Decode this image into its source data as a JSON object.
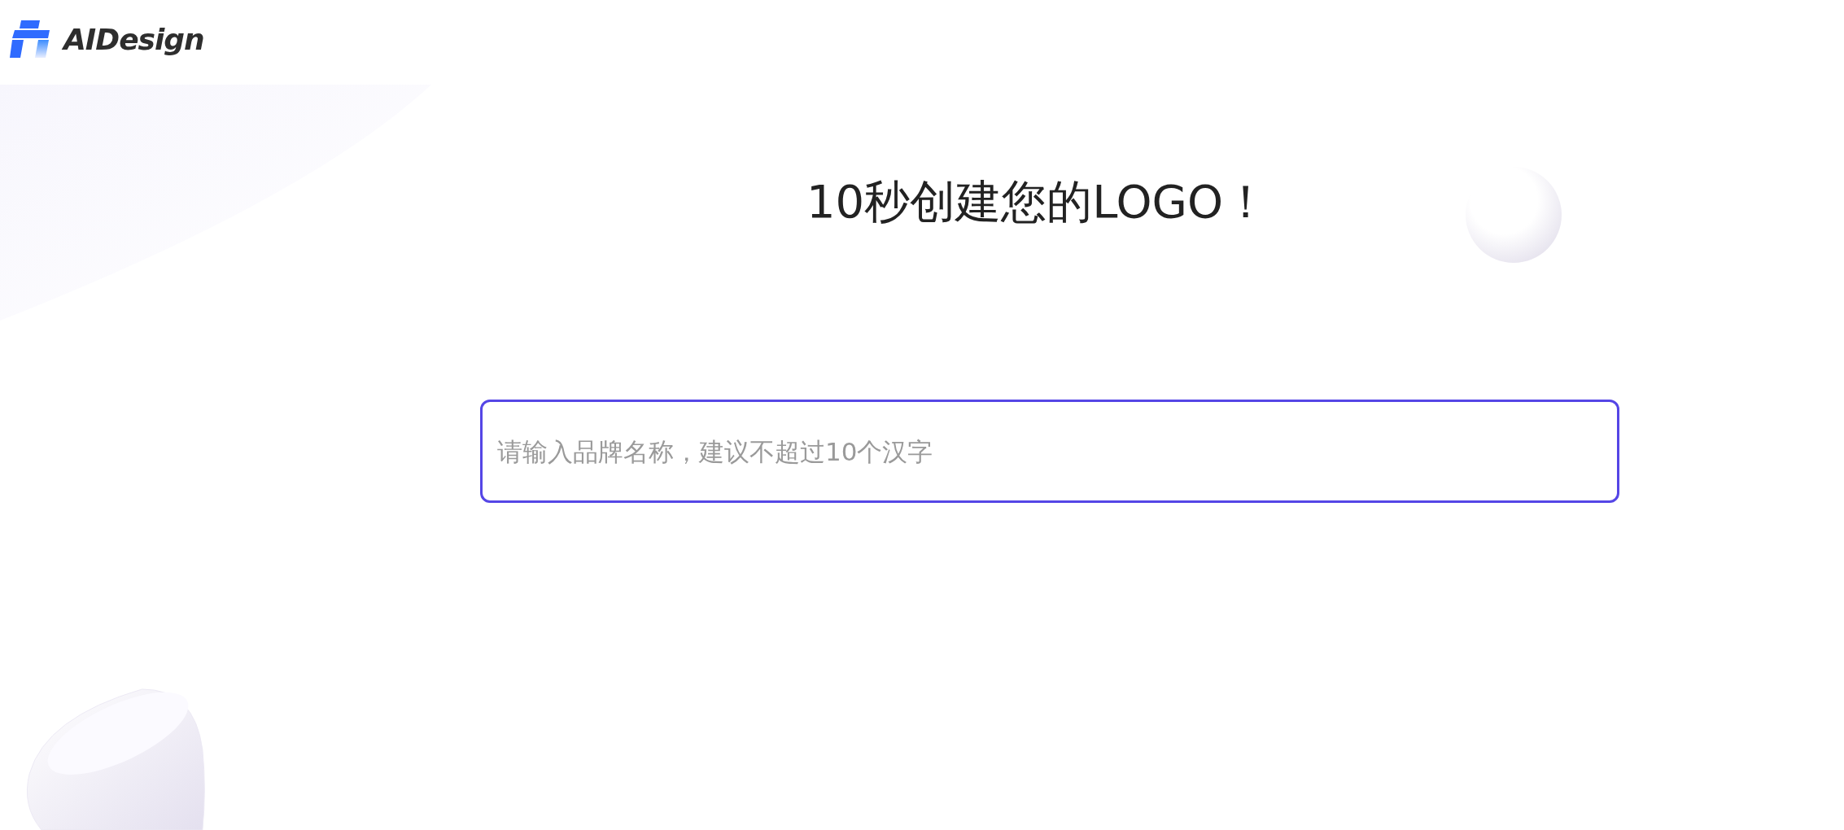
{
  "header": {
    "logo_text": "AIDesign"
  },
  "title": "10秒创建您的LOGO！",
  "brand_input": {
    "placeholder": "请输入品牌名称，建议不超过10个汉字",
    "focused": true
  }
}
